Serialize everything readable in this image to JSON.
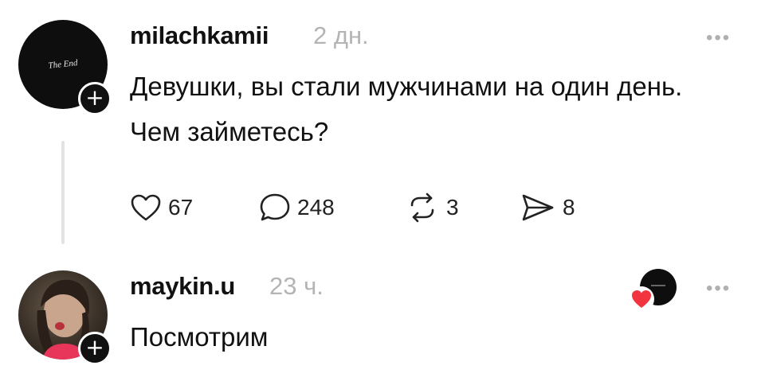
{
  "comment1": {
    "username": "milachkamii",
    "time": "2 дн.",
    "text": "Девушки, вы стали мужчинами на один день. Чем займетесь?",
    "avatar_logo": "The End",
    "more": "•••",
    "likes": "67",
    "replies": "248",
    "reposts": "3",
    "shares": "8"
  },
  "comment2": {
    "username": "maykin.u",
    "time": "23 ч.",
    "text": "Посмотрим",
    "more": "•••"
  },
  "colors": {
    "heart": "#f2343f",
    "muted": "#b4b4b4",
    "text": "#111111"
  },
  "icons": [
    "heart-icon",
    "comment-icon",
    "repost-icon",
    "share-icon",
    "plus-icon",
    "more-icon"
  ]
}
